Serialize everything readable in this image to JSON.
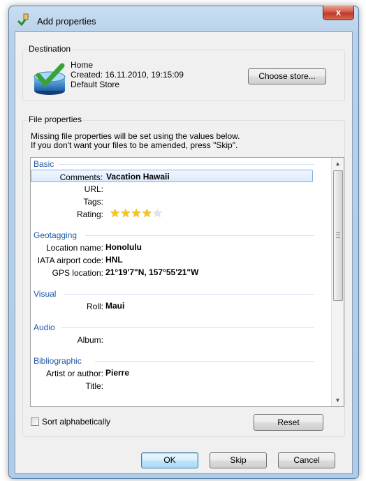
{
  "window": {
    "title": "Add properties",
    "close_glyph": "x"
  },
  "destination": {
    "group_label": "Destination",
    "line1": "Home",
    "line2": "Created: 16.11.2010, 19:15:09",
    "line3": "Default Store",
    "choose_label": "Choose store..."
  },
  "file_props": {
    "group_label": "File properties",
    "desc1": "Missing file properties will be set using the values below.",
    "desc2": "If you don't want your files to be amended, press \"Skip\"."
  },
  "grid": {
    "categories": {
      "basic": "Basic",
      "geotagging": "Geotagging",
      "visual": "Visual",
      "audio": "Audio",
      "bibliographic": "Bibliographic"
    },
    "rows": {
      "comments": {
        "label": "Comments:",
        "value": "Vacation Hawaii"
      },
      "url": {
        "label": "URL:",
        "value": ""
      },
      "tags": {
        "label": "Tags:",
        "value": ""
      },
      "rating": {
        "label": "Rating:",
        "value": 4,
        "max": 5
      },
      "location_name": {
        "label": "Location name:",
        "value": "Honolulu"
      },
      "iata": {
        "label": "IATA airport code:",
        "value": "HNL"
      },
      "gps": {
        "label": "GPS location:",
        "value": "21°19'7\"N, 157°55'21\"W"
      },
      "roll": {
        "label": "Roll:",
        "value": "Maui"
      },
      "album": {
        "label": "Album:",
        "value": ""
      },
      "artist": {
        "label": "Artist or author:",
        "value": "Pierre"
      },
      "title": {
        "label": "Title:",
        "value": ""
      }
    }
  },
  "sort_label": "Sort alphabetically",
  "buttons": {
    "reset": "Reset",
    "ok": "OK",
    "skip": "Skip",
    "cancel": "Cancel"
  },
  "icons": {
    "title": "add-properties-icon",
    "store": "store-checkmark-icon",
    "star_filled": "star-filled-icon",
    "star_empty": "star-empty-icon"
  },
  "colors": {
    "category_text": "#1f57a8",
    "star": "#f5c518",
    "selection": "#dbeafc"
  }
}
